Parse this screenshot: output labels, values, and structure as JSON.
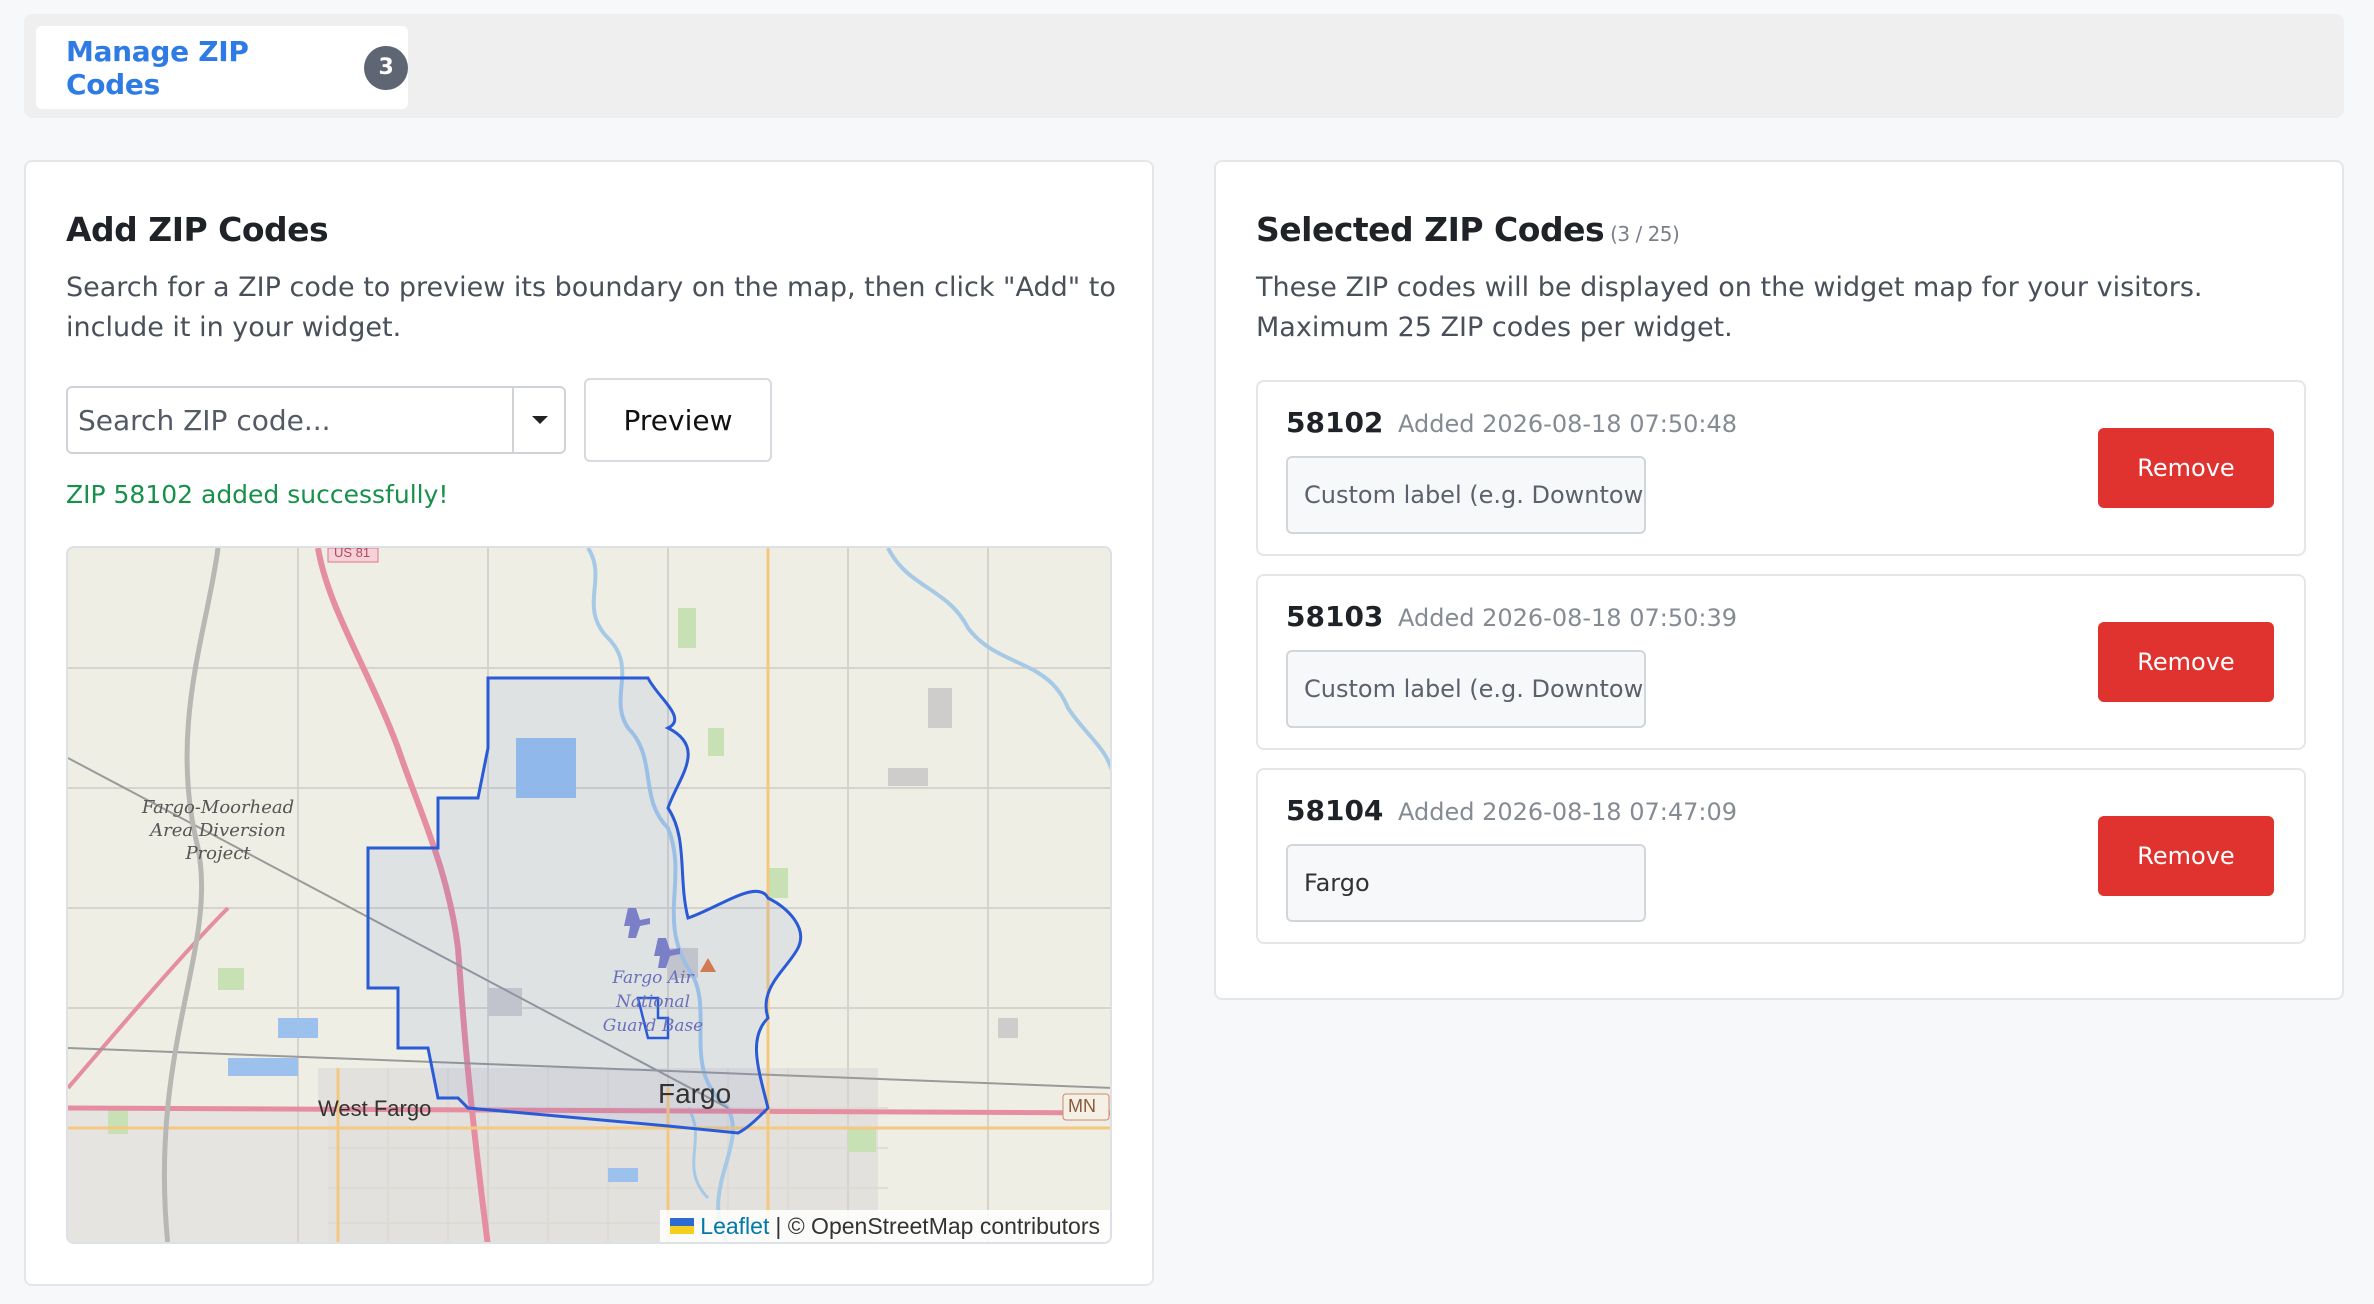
{
  "tabs": [
    {
      "label": "Manage ZIP Codes",
      "badge": "3"
    }
  ],
  "add_panel": {
    "title": "Add ZIP Codes",
    "description": "Search for a ZIP code to preview its boundary on the map, then click \"Add\" to include it in your widget.",
    "search_placeholder": "Search ZIP code...",
    "preview_label": "Preview",
    "success_message": "ZIP 58102 added successfully!"
  },
  "map": {
    "attribution_leaflet": "Leaflet",
    "attribution_rest": "| © OpenStreetMap contributors",
    "labels": {
      "project": "Fargo-Moorhead Area Diversion Project",
      "airbase": "Fargo Air National Guard Base",
      "city_fargo": "Fargo",
      "city_west_fargo": "West Fargo",
      "state": "MN",
      "route_us81": "US 81"
    },
    "boundary_color": "#2a5bd7"
  },
  "selected_panel": {
    "title": "Selected ZIP Codes",
    "count": "(3 / 25)",
    "description": "These ZIP codes will be displayed on the widget map for your visitors. Maximum 25 ZIP codes per widget.",
    "items": [
      {
        "zip": "58102",
        "added": "Added 2026-08-18 07:50:48",
        "label_value": "",
        "label_placeholder": "Custom label (e.g. Downtown)",
        "remove_label": "Remove"
      },
      {
        "zip": "58103",
        "added": "Added 2026-08-18 07:50:39",
        "label_value": "",
        "label_placeholder": "Custom label (e.g. Downtown)",
        "remove_label": "Remove"
      },
      {
        "zip": "58104",
        "added": "Added 2026-08-18 07:47:09",
        "label_value": "Fargo",
        "label_placeholder": "Custom label (e.g. Downtown)",
        "remove_label": "Remove"
      }
    ]
  },
  "colors": {
    "accent": "#2f7be6",
    "danger": "#e0322f",
    "success": "#17904a"
  }
}
